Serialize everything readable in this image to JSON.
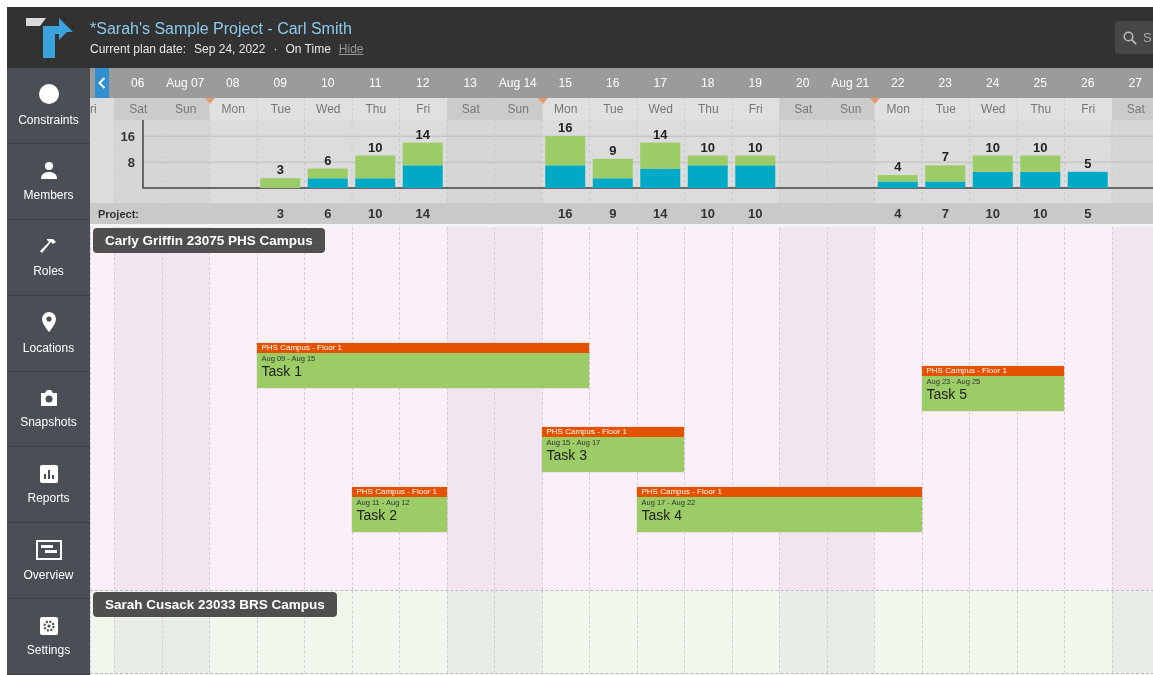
{
  "header": {
    "title": "*Sarah's Sample Project - Carl Smith",
    "plan_date_label": "Current plan date:",
    "plan_date": "Sep 24, 2022",
    "separator": "·",
    "status": "On Time",
    "hide_link": "Hide",
    "search": {
      "placeholder": "S"
    }
  },
  "sidebar": {
    "items": [
      {
        "label": "Constraints"
      },
      {
        "label": "Members"
      },
      {
        "label": "Roles"
      },
      {
        "label": "Locations"
      },
      {
        "label": "Snapshots"
      },
      {
        "label": "Reports"
      },
      {
        "label": "Overview"
      },
      {
        "label": "Settings"
      }
    ]
  },
  "timeline": {
    "leading_weekday": "ri",
    "project_label": "Project:",
    "days": [
      {
        "weekday": "Sat",
        "weekend": true,
        "week_start": false
      },
      {
        "weekday": "Sun",
        "weekend": true,
        "week_start": false
      },
      {
        "weekday": "Mon",
        "weekend": false,
        "week_start": true
      },
      {
        "weekday": "Tue",
        "weekend": false,
        "week_start": false,
        "project": "3"
      },
      {
        "weekday": "Wed",
        "weekend": false,
        "week_start": false,
        "project": "6"
      },
      {
        "weekday": "Thu",
        "weekend": false,
        "week_start": false,
        "project": "10"
      },
      {
        "weekday": "Fri",
        "weekend": false,
        "week_start": false,
        "project": "14"
      },
      {
        "weekday": "Sat",
        "weekend": true,
        "week_start": false
      },
      {
        "weekday": "Sun",
        "weekend": true,
        "week_start": false
      },
      {
        "weekday": "Mon",
        "weekend": false,
        "week_start": true,
        "project": "16"
      },
      {
        "weekday": "Tue",
        "weekend": false,
        "week_start": false,
        "project": "9"
      },
      {
        "weekday": "Wed",
        "weekend": false,
        "week_start": false,
        "project": "14"
      },
      {
        "weekday": "Thu",
        "weekend": false,
        "week_start": false,
        "project": "10"
      },
      {
        "weekday": "Fri",
        "weekend": false,
        "week_start": false,
        "project": "10"
      },
      {
        "weekday": "Sat",
        "weekend": true,
        "week_start": false
      },
      {
        "weekday": "Sun",
        "weekend": true,
        "week_start": false
      },
      {
        "weekday": "Mon",
        "weekend": false,
        "week_start": true,
        "project": "4"
      },
      {
        "weekday": "Tue",
        "weekend": false,
        "week_start": false,
        "project": "7"
      },
      {
        "weekday": "Wed",
        "weekend": false,
        "week_start": false,
        "project": "10"
      },
      {
        "weekday": "Thu",
        "weekend": false,
        "week_start": false,
        "project": "10"
      },
      {
        "weekday": "Fri",
        "weekend": false,
        "week_start": false,
        "project": "5"
      },
      {
        "weekday": "Sat",
        "weekend": true,
        "week_start": false
      }
    ],
    "chart_data": {
      "type": "bar",
      "stacked": true,
      "grid": true,
      "categories": [
        "06",
        "Aug 07",
        "08",
        "09",
        "10",
        "11",
        "12",
        "13",
        "Aug 14",
        "15",
        "16",
        "17",
        "18",
        "19",
        "20",
        "Aug 21",
        "22",
        "23",
        "24",
        "25",
        "26",
        "27"
      ],
      "yticks": [
        8,
        16
      ],
      "ylim": [
        0,
        21
      ],
      "series": [
        {
          "color": "#00a9c6",
          "values": [
            null,
            null,
            null,
            0,
            3,
            3,
            7,
            null,
            null,
            7,
            3,
            6,
            7,
            7,
            null,
            null,
            2,
            2,
            5,
            5,
            5,
            null
          ]
        },
        {
          "color": "#9ccc65",
          "values": [
            null,
            null,
            null,
            3,
            3,
            7,
            7,
            null,
            null,
            9,
            6,
            8,
            3,
            3,
            null,
            null,
            2,
            5,
            5,
            5,
            0,
            null
          ]
        }
      ],
      "annotations": [
        {
          "x": "09",
          "y": 3,
          "text": "3"
        },
        {
          "x": "10",
          "y": 6,
          "text": "6"
        },
        {
          "x": "11",
          "y": 10,
          "text": "10"
        },
        {
          "x": "12",
          "y": 14,
          "text": "14"
        },
        {
          "x": "15",
          "y": 16,
          "text": "16"
        },
        {
          "x": "16",
          "y": 9,
          "text": "9"
        },
        {
          "x": "17",
          "y": 14,
          "text": "14"
        },
        {
          "x": "18",
          "y": 10,
          "text": "10"
        },
        {
          "x": "19",
          "y": 10,
          "text": "10"
        },
        {
          "x": "22",
          "y": 4,
          "text": "4"
        },
        {
          "x": "23",
          "y": 7,
          "text": "7"
        },
        {
          "x": "24",
          "y": 10,
          "text": "10"
        },
        {
          "x": "25",
          "y": 10,
          "text": "10"
        },
        {
          "x": "26",
          "y": 5,
          "text": "5"
        }
      ]
    },
    "lanes": [
      {
        "title": "Carly Griffin 23075 PHS Campus",
        "color": "#fbf0f8",
        "tasks": [
          {
            "location": "PHS Campus - Floor 1",
            "dates": "Aug 09 - Aug 15",
            "name": "Task 1"
          },
          {
            "location": "PHS Campus - Floor 1",
            "dates": "Aug 23 - Aug 25",
            "name": "Task 5"
          },
          {
            "location": "PHS Campus - Floor 1",
            "dates": "Aug 15 - Aug 17",
            "name": "Task 3"
          },
          {
            "location": "PHS Campus - Floor 1",
            "dates": "Aug 11 - Aug 12",
            "name": "Task 2"
          },
          {
            "location": "PHS Campus - Floor 1",
            "dates": "Aug 17 - Aug 22",
            "name": "Task 4"
          }
        ]
      },
      {
        "title": "Sarah Cusack 23033 BRS Campus",
        "color": "#f0f8ee"
      }
    ]
  }
}
